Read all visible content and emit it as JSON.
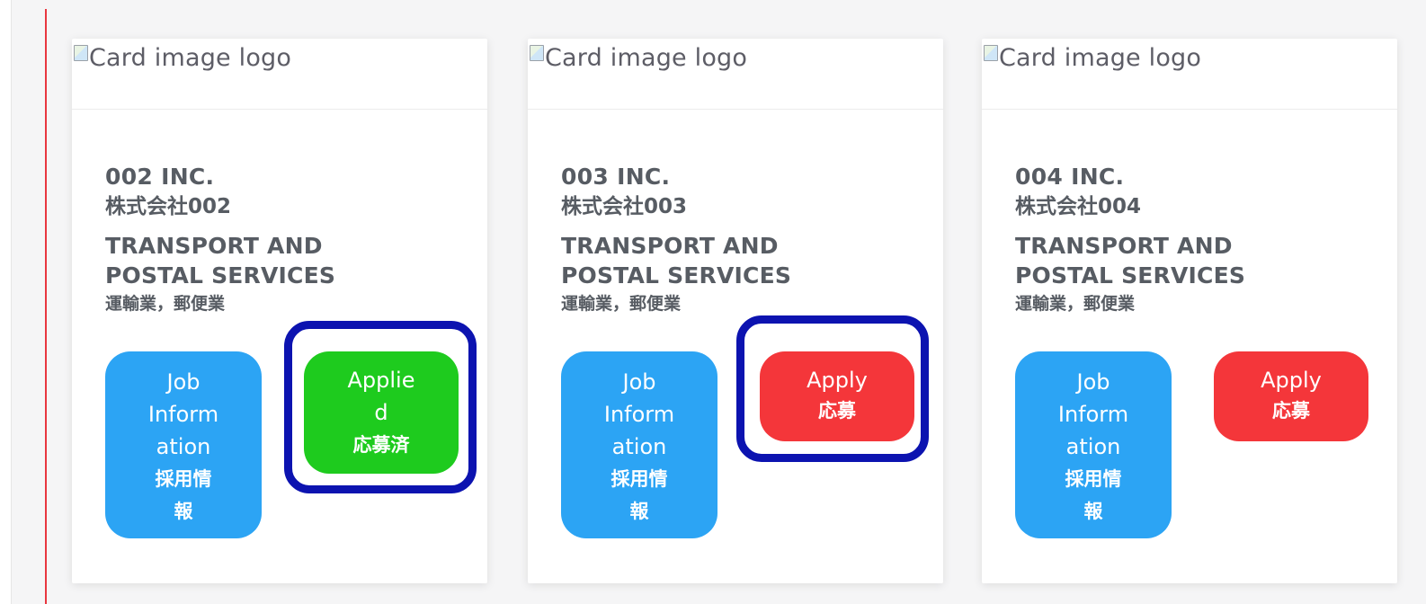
{
  "cards": [
    {
      "logo_alt": "Card image logo",
      "company_en": "002 INC.",
      "company_jp": "株式会社002",
      "industry_en_line1": "TRANSPORT AND",
      "industry_en_line2": "POSTAL SERVICES",
      "industry_jp": "運輸業，郵便業",
      "info_button": {
        "line1": "Job",
        "line2": "Inform",
        "line3": "ation",
        "line4": "採用情",
        "line5": "報"
      },
      "apply_button": {
        "state": "applied",
        "line1": "Applie",
        "line2": "d",
        "line3": "応募済"
      }
    },
    {
      "logo_alt": "Card image logo",
      "company_en": "003 INC.",
      "company_jp": "株式会社003",
      "industry_en_line1": "TRANSPORT AND",
      "industry_en_line2": "POSTAL SERVICES",
      "industry_jp": "運輸業，郵便業",
      "info_button": {
        "line1": "Job",
        "line2": "Inform",
        "line3": "ation",
        "line4": "採用情",
        "line5": "報"
      },
      "apply_button": {
        "state": "apply",
        "line1": "Apply",
        "line2": "応募"
      }
    },
    {
      "logo_alt": "Card image logo",
      "company_en": "004 INC.",
      "company_jp": "株式会社004",
      "industry_en_line1": "TRANSPORT AND",
      "industry_en_line2": "POSTAL SERVICES",
      "industry_jp": "運輸業，郵便業",
      "info_button": {
        "line1": "Job",
        "line2": "Inform",
        "line3": "ation",
        "line4": "採用情",
        "line5": "報"
      },
      "apply_button": {
        "state": "apply",
        "line1": "Apply",
        "line2": "応募"
      }
    }
  ],
  "colors": {
    "info_button": "#2ca4f4",
    "applied_button": "#1ecb1e",
    "apply_button": "#f4363a",
    "highlight_outline": "#0c13b0",
    "left_rule": "#e8373f"
  },
  "icons": {
    "broken_image": "broken-image-icon"
  }
}
